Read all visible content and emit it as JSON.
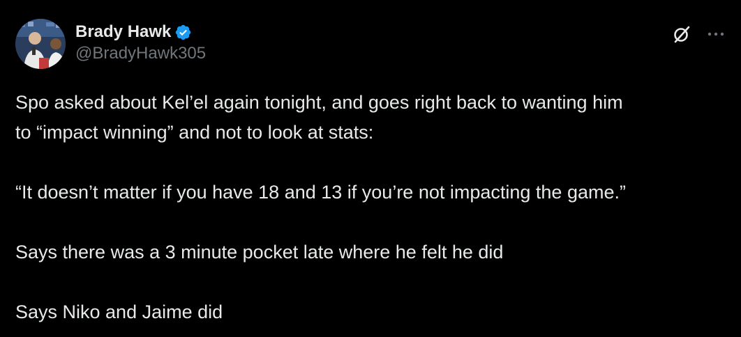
{
  "author": {
    "display_name": "Brady Hawk",
    "handle": "@BradyHawk305",
    "verified_icon": "verified-badge-icon",
    "avatar_icon": "avatar"
  },
  "actions": {
    "grok_icon": "grok-icon",
    "more_icon": "more-options-icon"
  },
  "tweet": {
    "paragraphs": [
      {
        "lines": [
          "Spo asked about Kel’el again tonight, and goes right back to wanting him",
          "to “impact winning” and not to look at stats:"
        ]
      },
      {
        "lines": [
          "“It doesn’t matter if you have 18 and 13 if you’re not impacting the game.”"
        ]
      },
      {
        "lines": [
          "Says there was a 3 minute pocket late where he felt he did"
        ]
      },
      {
        "lines": [
          "Says Niko and Jaime did"
        ]
      }
    ]
  },
  "colors": {
    "background": "#000000",
    "text_primary": "#e7e9ea",
    "text_secondary": "#71767b",
    "verified_blue": "#1d9bf0"
  }
}
